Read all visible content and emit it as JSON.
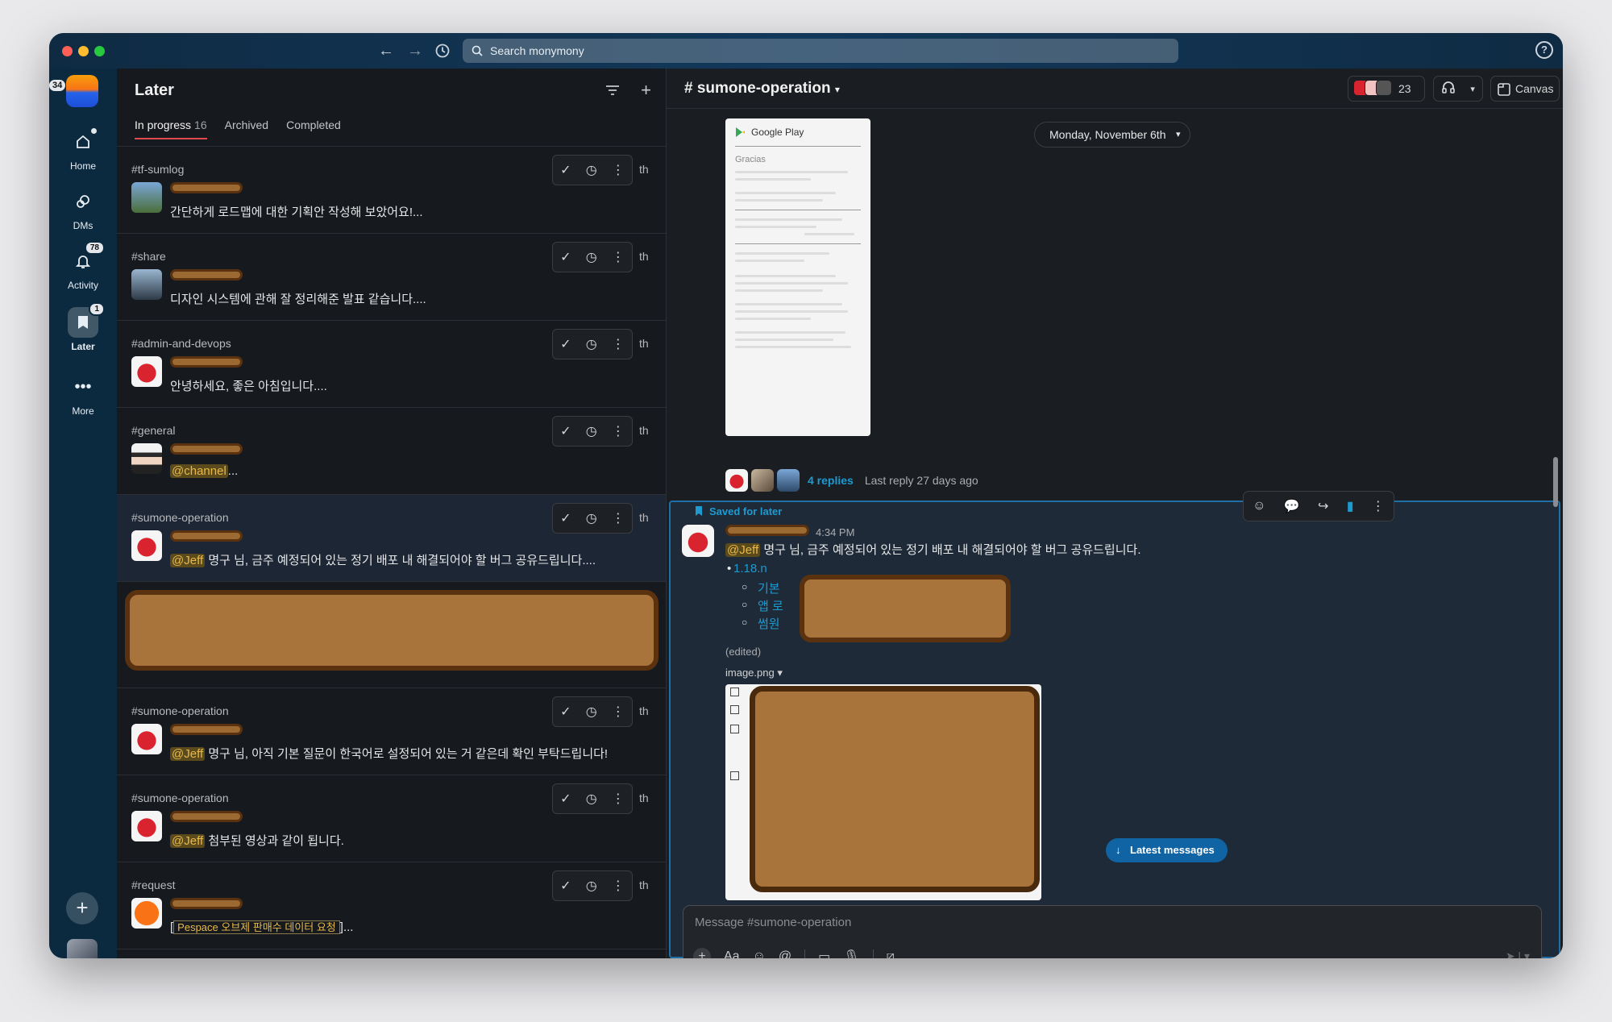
{
  "titlebar": {
    "search_placeholder": "Search monymony"
  },
  "rail": {
    "workspace_badge": "34",
    "items": [
      {
        "label": "Home",
        "badge": ""
      },
      {
        "label": "DMs",
        "badge": ""
      },
      {
        "label": "Activity",
        "badge": "78"
      },
      {
        "label": "Later",
        "badge": "1"
      },
      {
        "label": "More",
        "badge": ""
      }
    ]
  },
  "later": {
    "title": "Later",
    "tabs": [
      {
        "label": "In progress",
        "count": "16"
      },
      {
        "label": "Archived",
        "count": ""
      },
      {
        "label": "Completed",
        "count": ""
      }
    ],
    "items": [
      {
        "channel": "#tf-sumlog",
        "text": "간단하게 로드맵에 대한 기획안 작성해 보았어요!...",
        "mention": "",
        "tag": ""
      },
      {
        "channel": "#share",
        "text": "디자인 시스템에 관해 잘 정리해준 발표 같습니다....",
        "mention": "",
        "tag": ""
      },
      {
        "channel": "#admin-and-devops",
        "text": "안녕하세요, 좋은 아침입니다....",
        "mention": "",
        "tag": ""
      },
      {
        "channel": "#general",
        "text": "...",
        "mention": "@channel",
        "tag": ""
      },
      {
        "channel": "#sumone-operation",
        "text": "명구 님, 금주 예정되어 있는 정기 배포 내 해결되어야 할 버그 공유드립니다....",
        "mention": "@Jeff",
        "tag": ""
      },
      {
        "channel": "",
        "text": "",
        "mention": "",
        "tag": ""
      },
      {
        "channel": "#sumone-operation",
        "text": "명구 님, 아직 기본 질문이 한국어로 설정되어 있는 거 같은데 확인 부탁드립니다!",
        "mention": "@Jeff",
        "tag": ""
      },
      {
        "channel": "#sumone-operation",
        "text": "첨부된 영상과 같이 됩니다.",
        "mention": "@Jeff",
        "tag": ""
      },
      {
        "channel": "#request",
        "text": "]...",
        "mention": "",
        "tag": "Pespace 오브제 판매수 데이터 요청"
      }
    ],
    "th_label": "th"
  },
  "channel": {
    "title": "# sumone-operation",
    "member_count": "23",
    "canvas_label": "Canvas",
    "date_divider": "Monday, November 6th",
    "receipt_header": "Google Play",
    "receipt_greeting": "Gracias",
    "replies_count": "4 replies",
    "last_reply": "Last reply 27 days ago",
    "saved_label": "Saved for later",
    "message": {
      "time": "4:34 PM",
      "mention": "@Jeff",
      "text": "명구 님, 금주 예정되어 있는 정기 배포 내 해결되어야 할 버그 공유드립니다.",
      "bullet_version": "1.18.n",
      "sub_bullets": [
        "기본",
        "앱 로",
        "썸원"
      ],
      "edited": "(edited)",
      "image_name": "image.png"
    },
    "latest_messages": "Latest messages",
    "composer_placeholder": "Message #sumone-operation"
  },
  "colors": {
    "accent_link": "#1d9bd1",
    "rail_bg": "#0c2a3f",
    "panel_bg": "#16191e",
    "highlight_border": "#1d6fa5"
  }
}
